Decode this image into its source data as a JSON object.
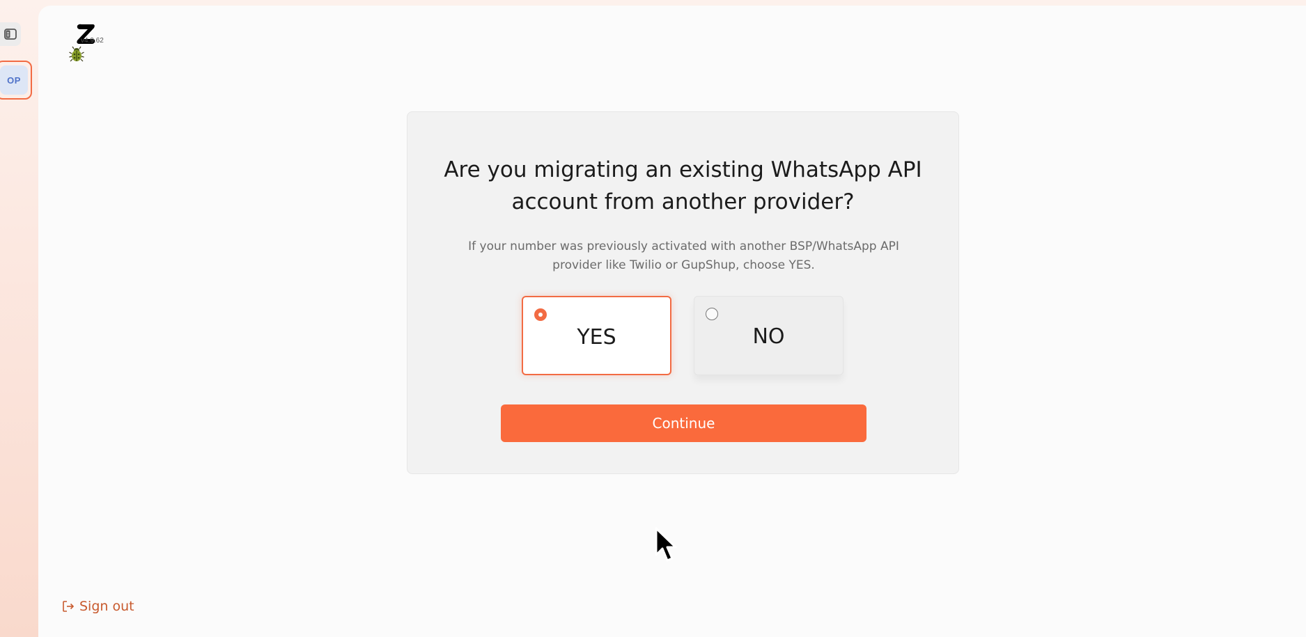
{
  "sidebar": {
    "workspace_initials": "OP"
  },
  "brand": {
    "version": "v4.9.62"
  },
  "question": {
    "title_line1": "Are you migrating an existing WhatsApp API",
    "title_line2": "account from another provider?",
    "subtitle_line1": "If your number was previously activated with another BSP/WhatsApp API",
    "subtitle_line2": "provider like Twilio or GupShup, choose YES."
  },
  "options": [
    {
      "label": "YES",
      "selected": true
    },
    {
      "label": "NO",
      "selected": false
    }
  ],
  "continue_label": "Continue",
  "signout_label": "Sign out",
  "colors": {
    "accent": "#fa6a3c",
    "selected_border": "#f26b43",
    "workspace_text": "#4f72c8",
    "signout_text": "#c85a2e"
  },
  "icons": {
    "panel_toggle": "sidebar-toggle-icon",
    "logo": "z-logo",
    "bug": "bug-icon",
    "signout": "sign-out-icon",
    "cursor": "mouse-pointer"
  }
}
